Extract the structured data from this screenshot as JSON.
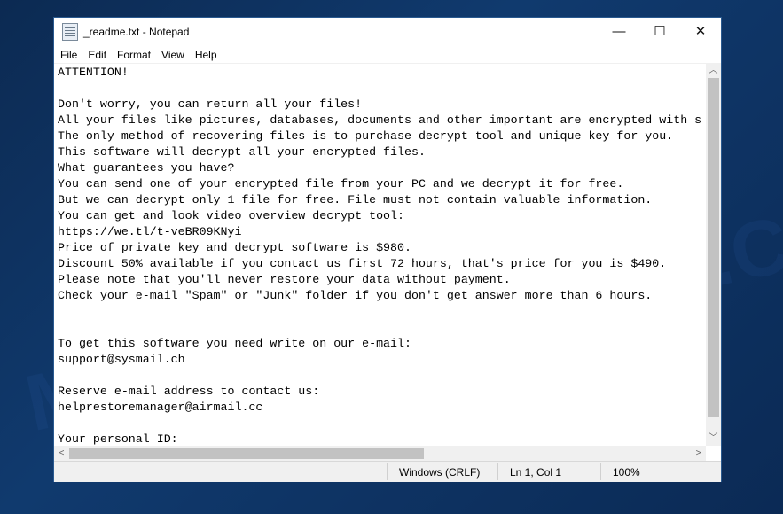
{
  "window": {
    "title": "_readme.txt - Notepad",
    "minimize": "—",
    "maximize": "☐",
    "close": "✕"
  },
  "menu": [
    "File",
    "Edit",
    "Format",
    "View",
    "Help"
  ],
  "content": "ATTENTION!\n\nDon't worry, you can return all your files!\nAll your files like pictures, databases, documents and other important are encrypted with s\nThe only method of recovering files is to purchase decrypt tool and unique key for you.\nThis software will decrypt all your encrypted files.\nWhat guarantees you have?\nYou can send one of your encrypted file from your PC and we decrypt it for free.\nBut we can decrypt only 1 file for free. File must not contain valuable information.\nYou can get and look video overview decrypt tool:\nhttps://we.tl/t-veBR09KNyi\nPrice of private key and decrypt software is $980.\nDiscount 50% available if you contact us first 72 hours, that's price for you is $490.\nPlease note that you'll never restore your data without payment.\nCheck your e-mail \"Spam\" or \"Junk\" folder if you don't get answer more than 6 hours.\n\n\nTo get this software you need write on our e-mail:\nsupport@sysmail.ch\n\nReserve e-mail address to contact us:\nhelprestoremanager@airmail.cc\n\nYour personal ID:",
  "status": {
    "line_ending": "Windows (CRLF)",
    "position": "Ln 1, Col 1",
    "zoom": "100%"
  },
  "watermark": "MYANTISPYWARE.COM"
}
